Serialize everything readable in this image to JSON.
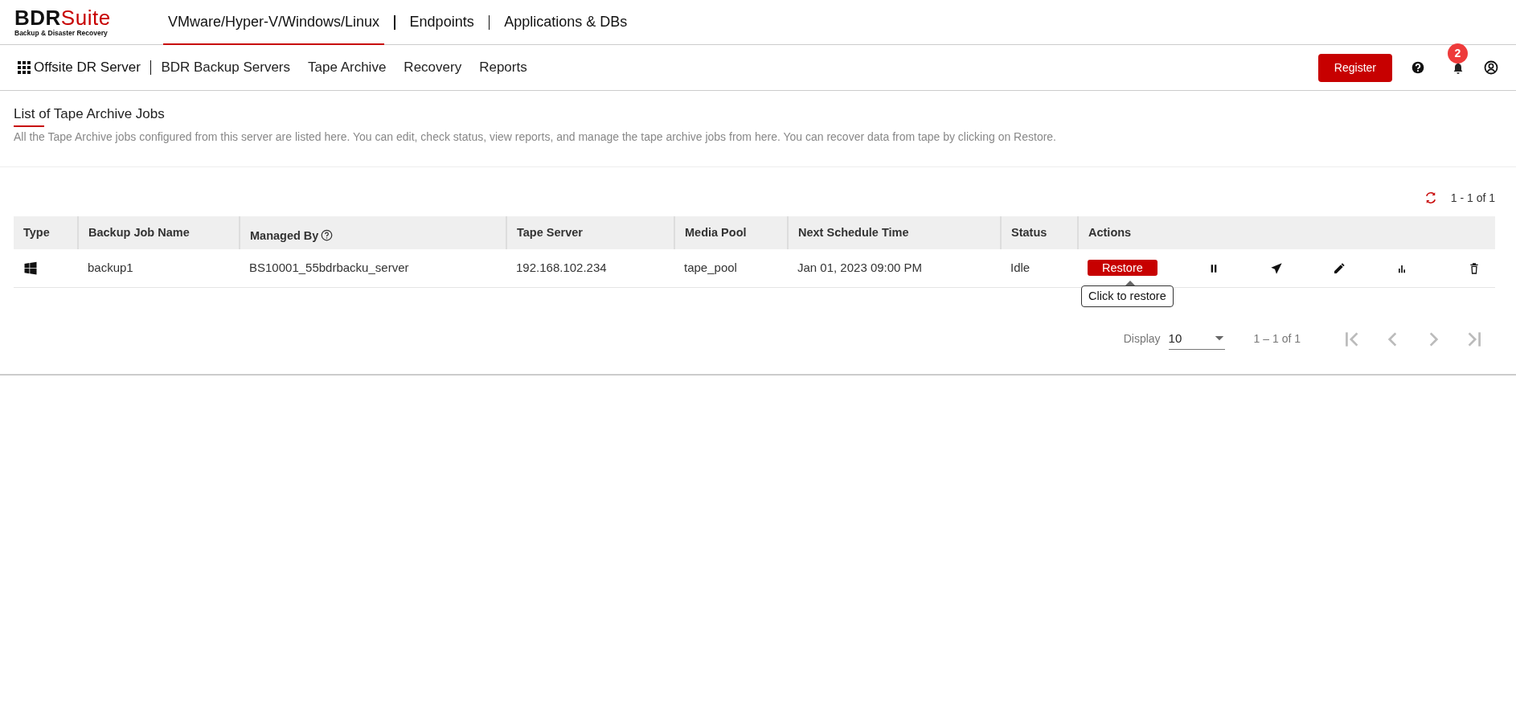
{
  "brand": {
    "name_dark": "BDR",
    "name_accent": "Suite",
    "tagline": "Backup & Disaster Recovery"
  },
  "product_tabs": [
    {
      "label": "VMware/Hyper-V/Windows/Linux",
      "selected": true
    },
    {
      "label": "Endpoints",
      "selected": false
    },
    {
      "label": "Applications & DBs",
      "selected": false
    }
  ],
  "sub_nav": {
    "home": "Offsite DR Server",
    "items": [
      {
        "label": "BDR Backup Servers"
      },
      {
        "label": "Tape Archive"
      },
      {
        "label": "Recovery"
      },
      {
        "label": "Reports"
      }
    ]
  },
  "register_button": "Register",
  "notification_count": "2",
  "page": {
    "title": "List of Tape Archive Jobs",
    "description": "All the Tape Archive jobs configured from this server are listed here. You can edit, check status, view reports, and manage the tape archive jobs from here. You can recover data from tape by clicking on Restore."
  },
  "record_count": "1 - 1 of 1",
  "table": {
    "columns": [
      "Type",
      "Backup Job Name",
      "Managed By",
      "Tape Server",
      "Media Pool",
      "Next Schedule Time",
      "Status",
      "Actions"
    ],
    "rows": [
      {
        "job_name": "backup1",
        "managed_by": "BS10001_55bdrbacku_server",
        "tape_server": "192.168.102.234",
        "media_pool": "tape_pool",
        "next_schedule": "Jan 01, 2023 09:00 PM",
        "status": "Idle",
        "restore_button": "Restore"
      }
    ]
  },
  "tooltip": "Click to restore",
  "pagination": {
    "display_label": "Display",
    "page_size": "10",
    "range": "1 – 1 of 1"
  }
}
